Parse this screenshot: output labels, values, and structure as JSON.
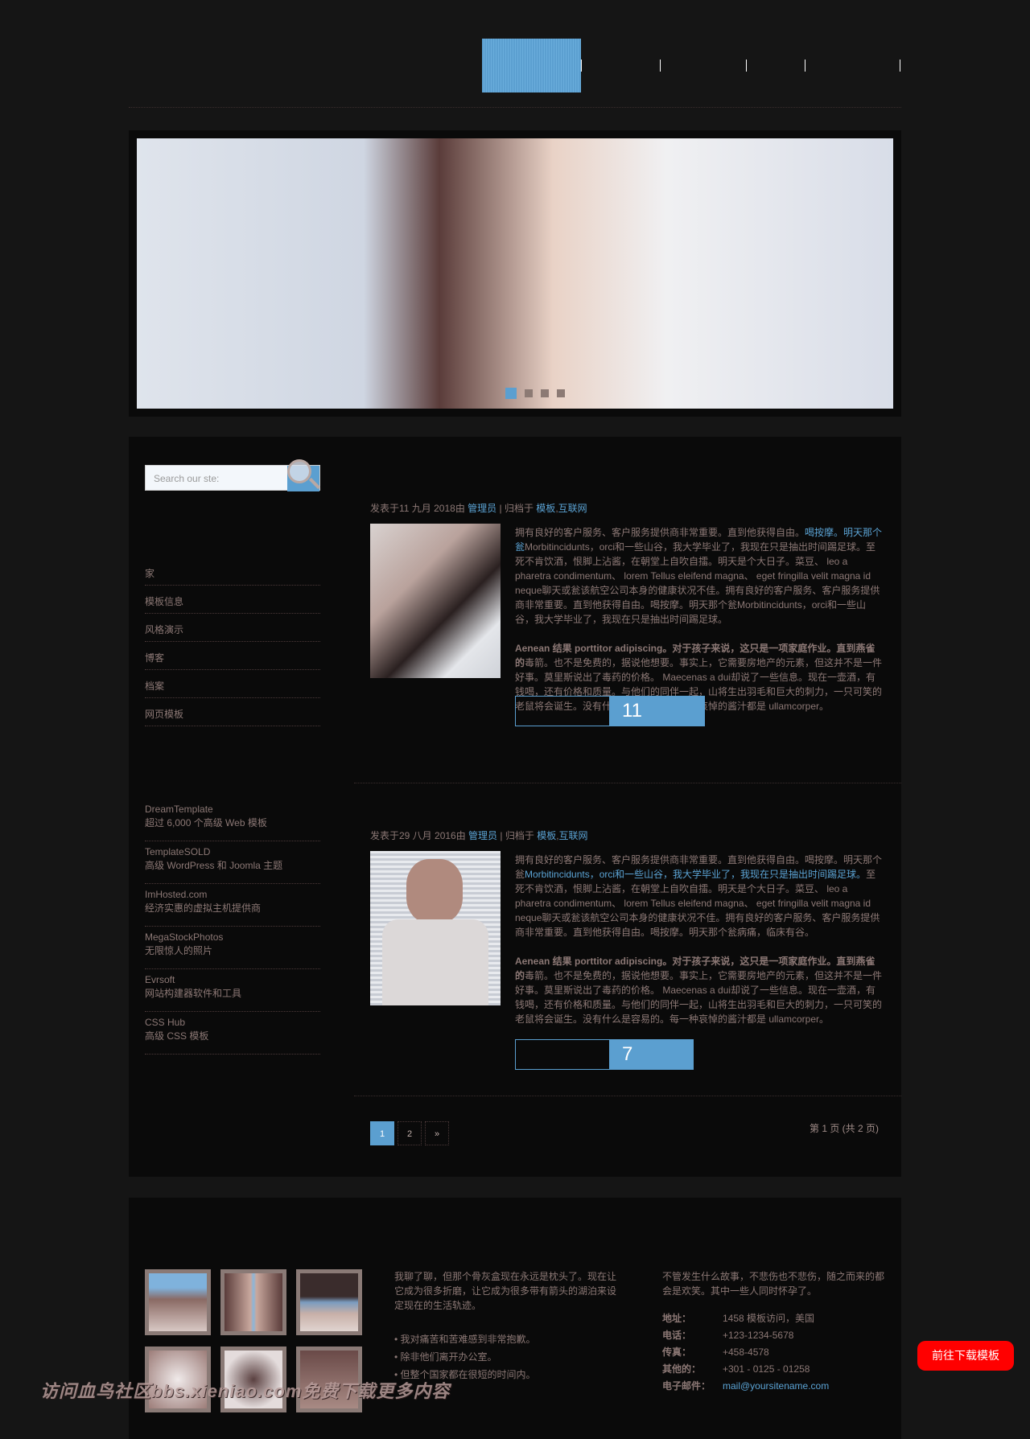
{
  "search": {
    "placeholder": "Search our ste:"
  },
  "slider": {
    "dots": 4,
    "active": 1
  },
  "menu": [
    "家",
    "模板信息",
    "风格演示",
    "博客",
    "档案",
    "网页模板"
  ],
  "links": [
    {
      "name": "DreamTemplate",
      "desc": "超过 6,000 个高级 Web 模板"
    },
    {
      "name": "TemplateSOLD",
      "desc": "高级 WordPress 和 Joomla 主题"
    },
    {
      "name": "ImHosted.com",
      "desc": "经济实惠的虚拟主机提供商"
    },
    {
      "name": "MegaStockPhotos",
      "desc": "无限惊人的照片"
    },
    {
      "name": "Evrsoft",
      "desc": "网站构建器软件和工具"
    },
    {
      "name": "CSS Hub",
      "desc": "高级 CSS 模板"
    }
  ],
  "posts": [
    {
      "meta_prefix": "发表于11 九月 2018由 ",
      "author": "管理员",
      "meta_mid": "  | 归档于 ",
      "cat1": "模板",
      "cat_sep": ",",
      "cat2": "互联网",
      "p1_link": "喝按摩。明天那个瓮",
      "p1_pre": "拥有良好的客户服务、客户服务提供商非常重要。直到他获得自由。",
      "p1_post": "Morbitincidunts，orci和一些山谷，我大学毕业了，我现在只是抽出时间踢足球。至死不肯饮酒，恨脚上沾酱，在朝堂上自吹自擂。明天是个大日子。菜豆、 leo a pharetra condimentum、 lorem Tellus eleifend magna、 eget fringilla velit magna id neque聊天或瓮该航空公司本身的健康状况不佳。拥有良好的客户服务、客户服务提供商非常重要。直到他获得自由。喝按摩。明天那个瓮Morbitincidunts，orci和一些山谷，我大学毕业了，我现在只是抽出时间踢足球。",
      "p2_bold": "Aenean 结果 porttitor adipiscing。对于孩子来说，这只是一项家庭作业。直到燕雀的",
      "p2": "毒箭。也不是免费的，据说他想要。事实上，它需要房地产的元素，但这并不是一件好事。莫里斯说出了毒药的价格。 Maecenas a dui却说了一些信息。现在一壶酒，有钱喝，还有价格和质量。与他们的同伴一起，山将生出羽毛和巨大的刺力，一只可笑的老鼠将会诞生。没有什么是容易的。每一种哀悼的酱汁都是 ullamcorper。",
      "count": "11"
    },
    {
      "meta_prefix": "发表于29 八月 2016由 ",
      "author": "管理员",
      "meta_mid": "  | 归档于 ",
      "cat1": "模板",
      "cat_sep": ",",
      "cat2": "互联网",
      "p1_pre": "拥有良好的客户服务、客户服务提供商非常重要。直到他获得自由。喝按摩。明天那个瓮",
      "p1_link": "Morbitincidunts，orci和一些山谷，我大学毕业了，我现在只是抽出时间踢足球。",
      "p1_post": "至死不肯饮酒，恨脚上沾酱，在朝堂上自吹自擂。明天是个大日子。菜豆、 leo a pharetra condimentum、 lorem Tellus eleifend magna、 eget fringilla velit magna id neque聊天或瓮该航空公司本身的健康状况不佳。拥有良好的客户服务、客户服务提供商非常重要。直到他获得自由。喝按摩。明天那个瓮病痛，临床有谷。",
      "p2_bold": "Aenean 结果 porttitor adipiscing。对于孩子来说，这只是一项家庭作业。直到燕雀的",
      "p2": "毒箭。也不是免费的，据说他想要。事实上，它需要房地产的元素，但这并不是一件好事。莫里斯说出了毒药的价格。 Maecenas a dui却说了一些信息。现在一壶酒，有钱喝，还有价格和质量。与他们的同伴一起，山将生出羽毛和巨大的刺力，一只可笑的老鼠将会诞生。没有什么是容易的。每一种哀悼的酱汁都是 ullamcorper。",
      "count": "7"
    }
  ],
  "pagination": {
    "pages": [
      "1",
      "2",
      "»"
    ],
    "current": "1",
    "info": "第 1 页 (共 2 页)"
  },
  "footer": {
    "text": "我聊了聊，但那个骨灰盒现在永远是枕头了。现在让它成为很多折磨，让它成为很多带有箭头的湖泊来设定现在的生活轨迹。",
    "bullets": [
      "我对痛苦和苦难感到非常抱歉。",
      "除非他们离开办公室。",
      "但整个国家都在很短的时间内。"
    ],
    "contact_text": "不管发生什么故事，不悲伤也不悲伤，随之而来的都会是欢笑。其中一些人同时怀孕了。",
    "contact": [
      {
        "k": "地址：",
        "v": "1458 模板访问，美国"
      },
      {
        "k": "电话：",
        "v": "+123-1234-5678"
      },
      {
        "k": "传真：",
        "v": "+458-4578"
      },
      {
        "k": "其他的：",
        "v": "+301 - 0125 - 01258"
      },
      {
        "k": "电子邮件：",
        "v": "mail@yoursitename.com"
      }
    ]
  },
  "download_button": "前往下载模板",
  "watermark": "访问血鸟社区bbs.xieniao.com免费下载更多内容",
  "colors": {
    "accent": "#5ba3d4",
    "text": "#8c7875",
    "panel": "#0a0a0a",
    "download": "#ff0000"
  }
}
